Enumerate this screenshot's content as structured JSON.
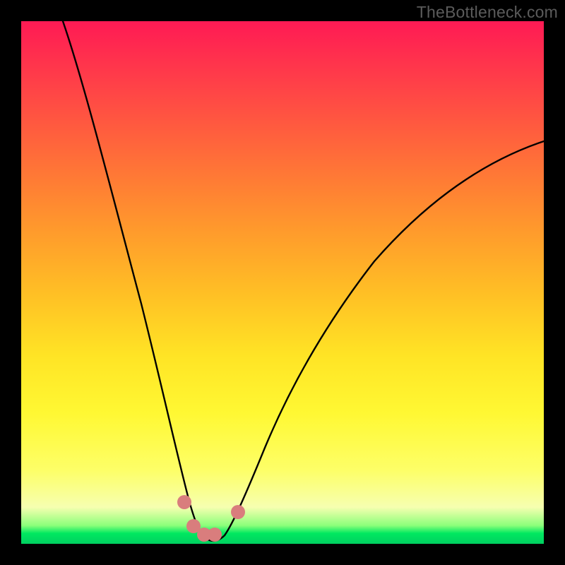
{
  "watermark": "TheBottleneck.com",
  "chart_data": {
    "type": "line",
    "title": "",
    "xlabel": "",
    "ylabel": "",
    "xlim": [
      0,
      100
    ],
    "ylim": [
      0,
      100
    ],
    "background_gradient": {
      "stops": [
        {
          "pos": 0,
          "color": "#ff1a54"
        },
        {
          "pos": 0.1,
          "color": "#ff3a4a"
        },
        {
          "pos": 0.2,
          "color": "#ff5a3f"
        },
        {
          "pos": 0.3,
          "color": "#ff7a35"
        },
        {
          "pos": 0.4,
          "color": "#ff9a2c"
        },
        {
          "pos": 0.52,
          "color": "#ffbf25"
        },
        {
          "pos": 0.64,
          "color": "#ffe425"
        },
        {
          "pos": 0.75,
          "color": "#fff833"
        },
        {
          "pos": 0.86,
          "color": "#fdff68"
        },
        {
          "pos": 0.93,
          "color": "#f6ffb0"
        },
        {
          "pos": 0.965,
          "color": "#8bff7a"
        },
        {
          "pos": 0.98,
          "color": "#00e860"
        },
        {
          "pos": 1.0,
          "color": "#00d060"
        }
      ]
    },
    "series": [
      {
        "name": "bottleneck-curve",
        "color": "#000000",
        "x": [
          8,
          11,
          15,
          19,
          23,
          27,
          30,
          32,
          34,
          36,
          38,
          41,
          44,
          48,
          54,
          62,
          72,
          84,
          100
        ],
        "y": [
          100,
          85,
          70,
          55,
          40,
          25,
          12,
          5,
          2,
          1,
          2,
          5,
          11,
          20,
          32,
          44,
          55,
          64,
          71
        ]
      }
    ],
    "markers": [
      {
        "name": "trough-marker-left",
        "x": 31.2,
        "y": 8.0,
        "color": "#d97d7d",
        "r": 1.5
      },
      {
        "name": "trough-marker-bottom1",
        "x": 33.0,
        "y": 2.5,
        "color": "#d97d7d",
        "r": 1.5
      },
      {
        "name": "trough-marker-bottom2",
        "x": 35.0,
        "y": 1.7,
        "color": "#d97d7d",
        "r": 1.5
      },
      {
        "name": "trough-marker-bottom3",
        "x": 37.0,
        "y": 1.6,
        "color": "#d97d7d",
        "r": 1.5
      },
      {
        "name": "trough-marker-right",
        "x": 41.5,
        "y": 6.0,
        "color": "#d97d7d",
        "r": 1.5
      }
    ]
  }
}
